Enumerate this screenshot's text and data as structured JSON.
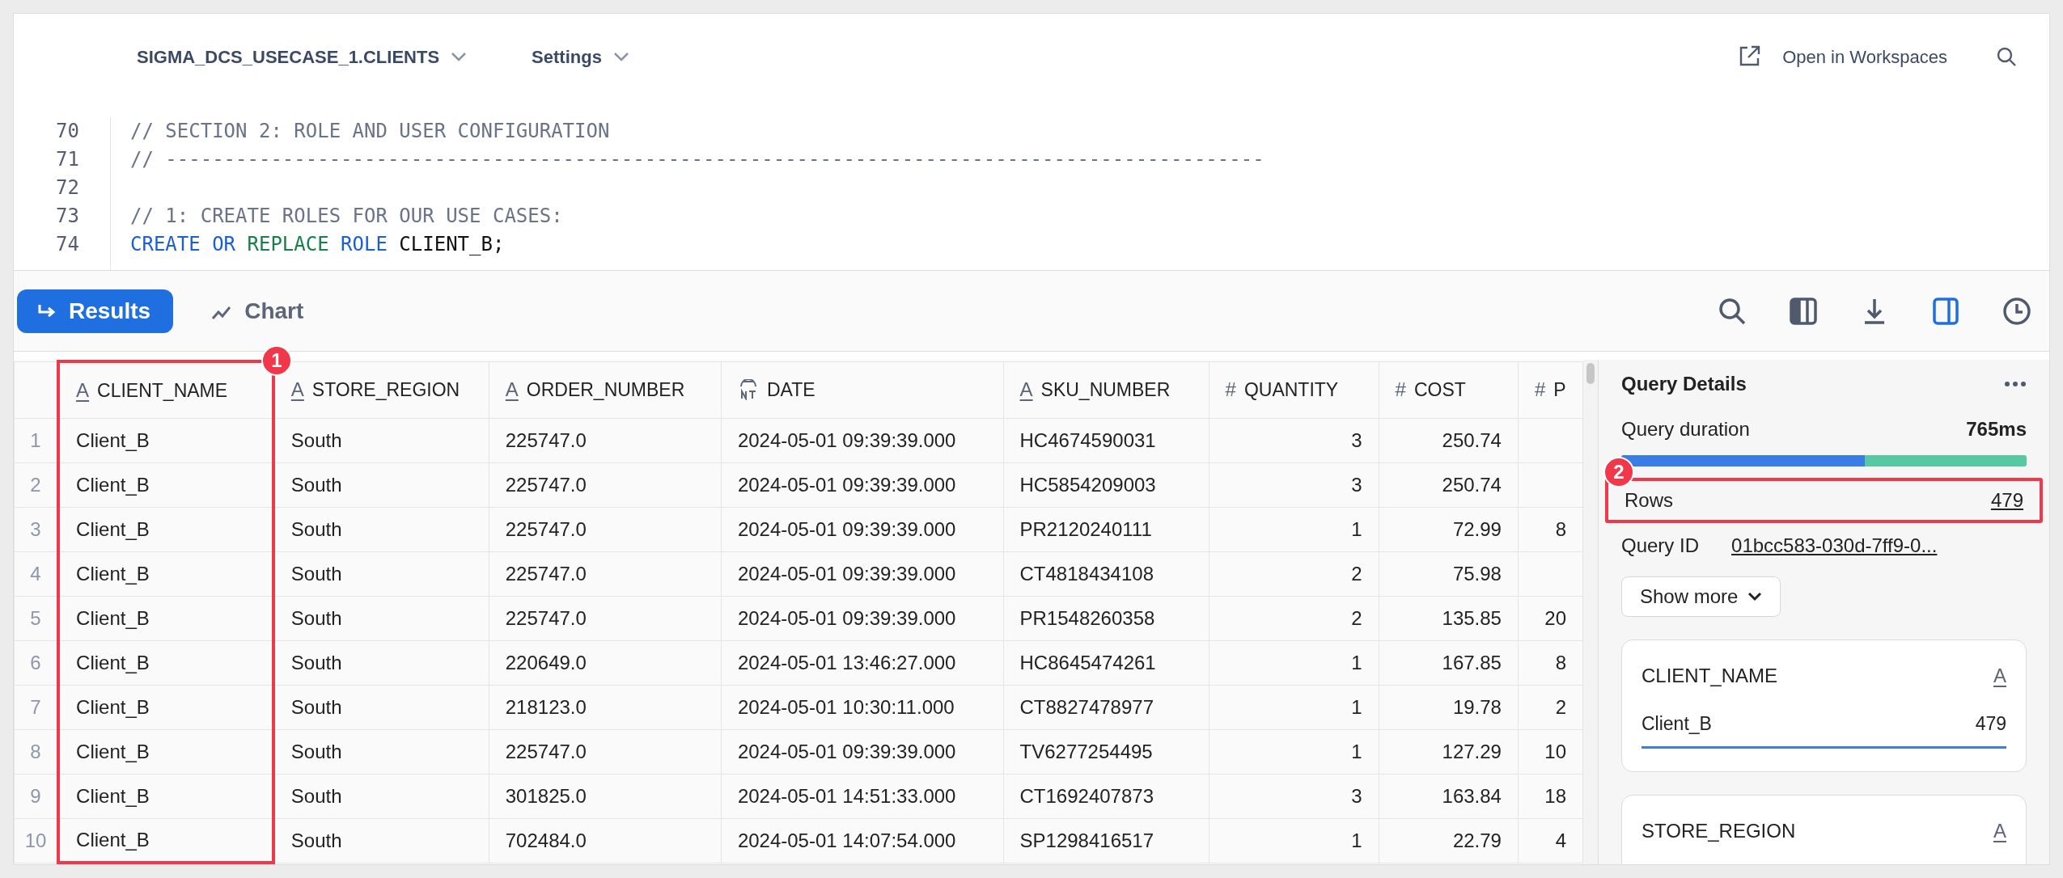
{
  "header": {
    "source": "SIGMA_DCS_USECASE_1.CLIENTS",
    "settings": "Settings",
    "open_link": "Open in Workspaces"
  },
  "editor": {
    "lines": [
      {
        "number": "70",
        "tokens": [
          {
            "text": "// SECTION 2: ROLE AND USER CONFIGURATION",
            "kind": "comment"
          }
        ]
      },
      {
        "number": "71",
        "tokens": [
          {
            "text": "// ----------------------------------------------------------------------------------------------",
            "kind": "comment"
          }
        ]
      },
      {
        "number": "72"
      },
      {
        "number": "73",
        "tokens": [
          {
            "text": "// 1: CREATE ROLES FOR OUR USE CASES:",
            "kind": "comment"
          }
        ]
      },
      {
        "number": "74",
        "tokens": [
          {
            "text": "CREATE OR",
            "kind": "keyword"
          },
          {
            "text": " REPLACE ",
            "kind": "function"
          },
          {
            "text": "ROLE",
            "kind": "keyword"
          },
          {
            "text": " CLIENT_B;",
            "kind": "plain"
          }
        ]
      }
    ]
  },
  "tabs": [
    {
      "label": "Results",
      "kind": "results",
      "selected": true
    },
    {
      "label": "Chart",
      "kind": "chart",
      "selected": false
    }
  ],
  "toolbar": [
    {
      "kind": "search",
      "selected": false
    },
    {
      "kind": "columns",
      "selected": false
    },
    {
      "kind": "download",
      "selected": false
    },
    {
      "kind": "panel",
      "selected": true
    },
    {
      "kind": "history",
      "selected": false
    }
  ],
  "table": {
    "columns": [
      {
        "name": "CLIENT_NAME",
        "kind": "text",
        "icon": "A",
        "annotation": "1"
      },
      {
        "name": "STORE_REGION",
        "kind": "text",
        "icon": "A"
      },
      {
        "name": "ORDER_NUMBER",
        "kind": "text",
        "icon": "A"
      },
      {
        "name": "DATE",
        "kind": "datetime"
      },
      {
        "name": "SKU_NUMBER",
        "kind": "text",
        "icon": "A"
      },
      {
        "name": "QUANTITY",
        "kind": "number",
        "icon": "#"
      },
      {
        "name": "COST",
        "kind": "number",
        "icon": "#"
      },
      {
        "name": "P",
        "kind": "number",
        "icon": "#"
      }
    ],
    "rows": [
      {
        "index": "1",
        "cells": [
          "Client_B",
          "South",
          "225747.0",
          "2024-05-01 09:39:39.000",
          "HC4674590031",
          "3",
          "250.74"
        ]
      },
      {
        "index": "2",
        "cells": [
          "Client_B",
          "South",
          "225747.0",
          "2024-05-01 09:39:39.000",
          "HC5854209003",
          "3",
          "250.74"
        ]
      },
      {
        "index": "3",
        "cells": [
          "Client_B",
          "South",
          "225747.0",
          "2024-05-01 09:39:39.000",
          "PR2120240111",
          "1",
          "72.99",
          "8"
        ]
      },
      {
        "index": "4",
        "cells": [
          "Client_B",
          "South",
          "225747.0",
          "2024-05-01 09:39:39.000",
          "CT4818434108",
          "2",
          "75.98"
        ]
      },
      {
        "index": "5",
        "cells": [
          "Client_B",
          "South",
          "225747.0",
          "2024-05-01 09:39:39.000",
          "PR1548260358",
          "2",
          "135.85",
          "20"
        ]
      },
      {
        "index": "6",
        "cells": [
          "Client_B",
          "South",
          "220649.0",
          "2024-05-01 13:46:27.000",
          "HC8645474261",
          "1",
          "167.85",
          "8"
        ]
      },
      {
        "index": "7",
        "cells": [
          "Client_B",
          "South",
          "218123.0",
          "2024-05-01 10:30:11.000",
          "CT8827478977",
          "1",
          "19.78",
          "2"
        ]
      },
      {
        "index": "8",
        "cells": [
          "Client_B",
          "South",
          "225747.0",
          "2024-05-01 09:39:39.000",
          "TV6277254495",
          "1",
          "127.29",
          "10"
        ]
      },
      {
        "index": "9",
        "cells": [
          "Client_B",
          "South",
          "301825.0",
          "2024-05-01 14:51:33.000",
          "CT1692407873",
          "3",
          "163.84",
          "18"
        ]
      },
      {
        "index": "10",
        "cells": [
          "Client_B",
          "South",
          "702484.0",
          "2024-05-01 14:07:54.000",
          "SP1298416517",
          "1",
          "22.79",
          "4"
        ]
      }
    ]
  },
  "details": {
    "title": "Query Details",
    "duration_label": "Query duration",
    "duration": "765ms",
    "duration_bar": {
      "level": 0.6
    },
    "rows_label": "Rows",
    "rows": "479",
    "rows_annotation": "2",
    "query_id_label": "Query ID",
    "query_id": "01bcc583-030d-7ff9-0...",
    "show_more": "Show more",
    "summaries": [
      {
        "column": "CLIENT_NAME",
        "icon": "A",
        "values": [
          {
            "label": "Client_B",
            "count": "479",
            "level": 1
          }
        ]
      },
      {
        "column": "STORE_REGION",
        "icon": "A"
      }
    ]
  }
}
